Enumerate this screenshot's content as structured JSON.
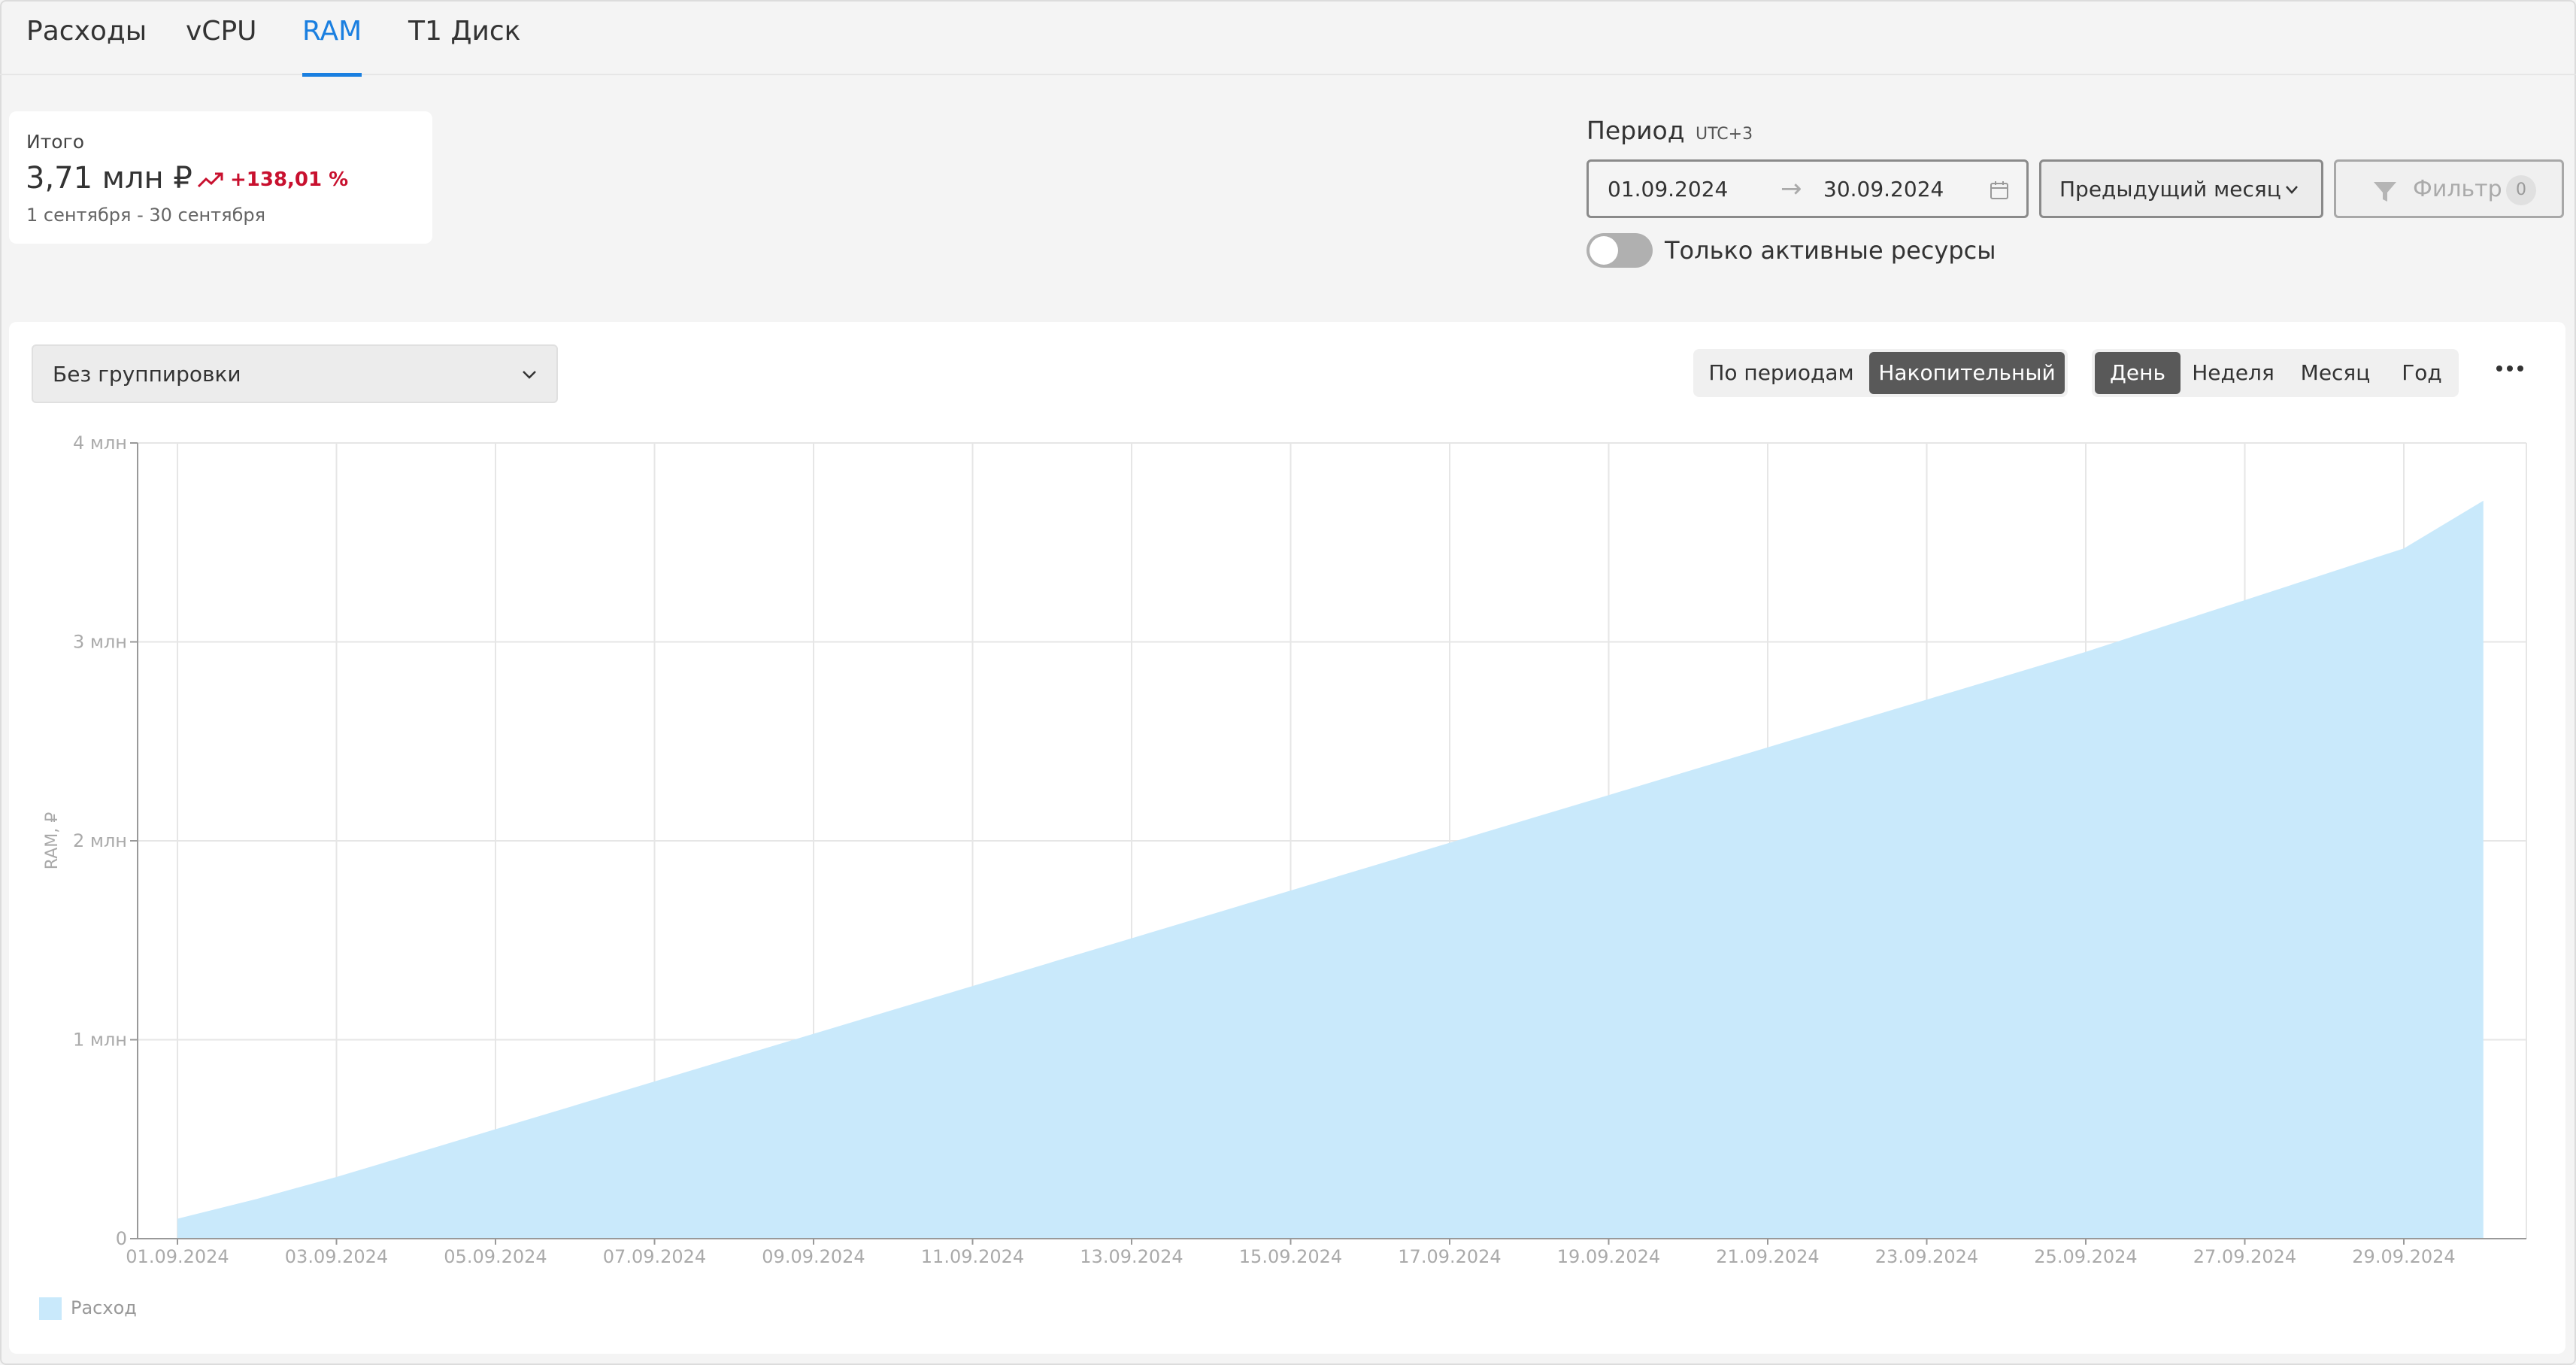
{
  "tabs": [
    {
      "label": "Расходы",
      "active": false
    },
    {
      "label": "vCPU",
      "active": false
    },
    {
      "label": "RAM",
      "active": true
    },
    {
      "label": "T1 Диск",
      "active": false
    }
  ],
  "summary": {
    "label": "Итого",
    "amount": "3,71 млн ₽",
    "trend": "+138,01 %",
    "dates": "1 сентября - 30 сентября"
  },
  "period": {
    "title": "Период",
    "timezone": "UTC+3",
    "from": "01.09.2024",
    "to": "30.09.2024",
    "preset": "Предыдущий месяц",
    "filter_label": "Фильтр",
    "filter_count": "0",
    "active_only_label": "Только активные ресурсы",
    "active_only": false
  },
  "controls": {
    "grouping": "Без группировки",
    "mode_options": [
      {
        "label": "По периодам",
        "active": false
      },
      {
        "label": "Накопительный",
        "active": true
      }
    ],
    "granularity_options": [
      {
        "label": "День",
        "active": true
      },
      {
        "label": "Неделя",
        "active": false
      },
      {
        "label": "Месяц",
        "active": false
      },
      {
        "label": "Год",
        "active": false
      }
    ]
  },
  "colors": {
    "accent": "#1a7fe0",
    "area": "#c9e9fb",
    "trend": "#c8102e"
  },
  "chart_data": {
    "type": "area",
    "ylabel": "RAM, ₽",
    "y_ticks": [
      {
        "value": 0,
        "label": "0"
      },
      {
        "value": 1000000,
        "label": "1 млн"
      },
      {
        "value": 2000000,
        "label": "2 млн"
      },
      {
        "value": 3000000,
        "label": "3 млн"
      },
      {
        "value": 4000000,
        "label": "4 млн"
      }
    ],
    "ylim": [
      0,
      4000000
    ],
    "x_tick_labels": [
      "01.09.2024",
      "03.09.2024",
      "05.09.2024",
      "07.09.2024",
      "09.09.2024",
      "11.09.2024",
      "13.09.2024",
      "15.09.2024",
      "17.09.2024",
      "19.09.2024",
      "21.09.2024",
      "23.09.2024",
      "25.09.2024",
      "27.09.2024",
      "29.09.2024"
    ],
    "grid": true,
    "legend_position": "bottom-left",
    "series": [
      {
        "name": "Расход",
        "x": [
          "01.09.2024",
          "02.09.2024",
          "03.09.2024",
          "04.09.2024",
          "05.09.2024",
          "06.09.2024",
          "07.09.2024",
          "08.09.2024",
          "09.09.2024",
          "10.09.2024",
          "11.09.2024",
          "12.09.2024",
          "13.09.2024",
          "14.09.2024",
          "15.09.2024",
          "16.09.2024",
          "17.09.2024",
          "18.09.2024",
          "19.09.2024",
          "20.09.2024",
          "21.09.2024",
          "22.09.2024",
          "23.09.2024",
          "24.09.2024",
          "25.09.2024",
          "26.09.2024",
          "27.09.2024",
          "28.09.2024",
          "29.09.2024",
          "30.09.2024"
        ],
        "values": [
          100000,
          200000,
          310000,
          430000,
          550000,
          670000,
          790000,
          910000,
          1030000,
          1150000,
          1270000,
          1390000,
          1510000,
          1630000,
          1750000,
          1870000,
          1990000,
          2110000,
          2230000,
          2350000,
          2470000,
          2590000,
          2710000,
          2830000,
          2950000,
          3080000,
          3210000,
          3340000,
          3470000,
          3710000
        ]
      }
    ]
  }
}
